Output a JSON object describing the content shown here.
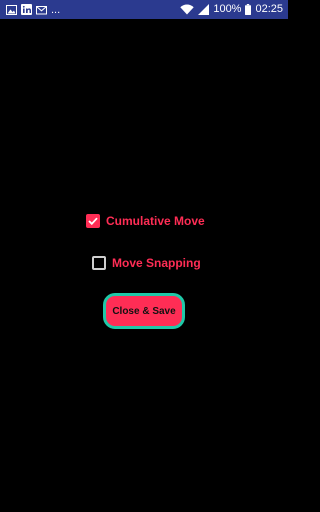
{
  "status_bar": {
    "notification_icons": [
      "image-icon",
      "linkedin-icon",
      "mail-icon"
    ],
    "overflow": "...",
    "battery": "100%",
    "time": "02:25"
  },
  "options": {
    "cumulative_move": {
      "label": "Cumulative Move",
      "checked": true
    },
    "move_snapping": {
      "label": "Move Snapping",
      "checked": false
    }
  },
  "actions": {
    "save_label": "Close & Save"
  },
  "colors": {
    "accent": "#ff2d55",
    "button_border": "#1ec9a8",
    "status_bar": "#2b3a8f",
    "background": "#000000"
  }
}
